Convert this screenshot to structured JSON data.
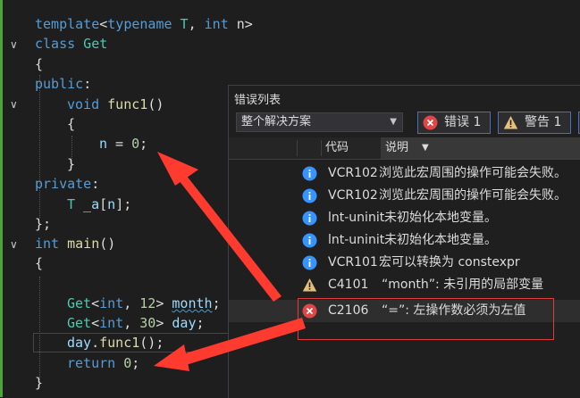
{
  "code": {
    "lines": [
      {
        "id": "l1",
        "tokens": [
          {
            "c": "kw",
            "t": "template"
          },
          {
            "c": "pl",
            "t": "<"
          },
          {
            "c": "kw",
            "t": "typename"
          },
          {
            "c": "ty",
            "t": " T"
          },
          {
            "c": "pl",
            "t": ", "
          },
          {
            "c": "kw",
            "t": "int"
          },
          {
            "c": "pl",
            "t": " n>"
          }
        ]
      },
      {
        "id": "l2",
        "tokens": [
          {
            "c": "kw",
            "t": "class"
          },
          {
            "c": "ty",
            "t": " Get"
          }
        ]
      },
      {
        "id": "l3",
        "tokens": [
          {
            "c": "pl",
            "t": "{"
          }
        ]
      },
      {
        "id": "l4",
        "tokens": [
          {
            "c": "kw",
            "t": "public"
          },
          {
            "c": "pl",
            "t": ":"
          }
        ]
      },
      {
        "id": "l5",
        "tokens": [
          {
            "c": "kw",
            "t": "void"
          },
          {
            "c": "fn",
            "t": " func1"
          },
          {
            "c": "pl",
            "t": "()"
          }
        ]
      },
      {
        "id": "l6",
        "tokens": [
          {
            "c": "pl",
            "t": "{"
          }
        ]
      },
      {
        "id": "l7",
        "tokens": [
          {
            "c": "vr",
            "t": "n"
          },
          {
            "c": "pl",
            "t": " = "
          },
          {
            "c": "nm",
            "t": "0"
          },
          {
            "c": "pl",
            "t": ";"
          }
        ]
      },
      {
        "id": "l8",
        "tokens": [
          {
            "c": "pl",
            "t": "}"
          }
        ]
      },
      {
        "id": "l9",
        "tokens": [
          {
            "c": "kw",
            "t": "private"
          },
          {
            "c": "pl",
            "t": ":"
          }
        ]
      },
      {
        "id": "l10",
        "tokens": [
          {
            "c": "ty",
            "t": "T"
          },
          {
            "c": "vr",
            "t": " _a"
          },
          {
            "c": "pl",
            "t": "["
          },
          {
            "c": "vr",
            "t": "n"
          },
          {
            "c": "pl",
            "t": "];"
          }
        ]
      },
      {
        "id": "l11",
        "tokens": [
          {
            "c": "pl",
            "t": "};"
          }
        ]
      },
      {
        "id": "l12",
        "tokens": [
          {
            "c": "kw",
            "t": "int"
          },
          {
            "c": "fn",
            "t": " main"
          },
          {
            "c": "pl",
            "t": "()"
          }
        ]
      },
      {
        "id": "l13",
        "tokens": [
          {
            "c": "pl",
            "t": "{"
          }
        ]
      },
      {
        "id": "l14",
        "tokens": []
      },
      {
        "id": "l15",
        "tokens": [
          {
            "c": "ty",
            "t": "Get"
          },
          {
            "c": "pl",
            "t": "<"
          },
          {
            "c": "kw",
            "t": "int"
          },
          {
            "c": "pl",
            "t": ", "
          },
          {
            "c": "nm",
            "t": "12"
          },
          {
            "c": "pl",
            "t": "> "
          },
          {
            "c": "vr squig",
            "t": "month"
          },
          {
            "c": "pl",
            "t": ";"
          }
        ]
      },
      {
        "id": "l16",
        "tokens": [
          {
            "c": "ty",
            "t": "Get"
          },
          {
            "c": "pl",
            "t": "<"
          },
          {
            "c": "kw",
            "t": "int"
          },
          {
            "c": "pl",
            "t": ", "
          },
          {
            "c": "nm",
            "t": "30"
          },
          {
            "c": "pl",
            "t": "> "
          },
          {
            "c": "vr",
            "t": "day"
          },
          {
            "c": "pl",
            "t": ";"
          }
        ]
      },
      {
        "id": "l17",
        "tokens": [
          {
            "c": "vr",
            "t": "day"
          },
          {
            "c": "pl",
            "t": "."
          },
          {
            "c": "fn",
            "t": "func1"
          },
          {
            "c": "pl",
            "t": "();"
          }
        ]
      },
      {
        "id": "l18",
        "tokens": [
          {
            "c": "kw",
            "t": "return"
          },
          {
            "c": "nm",
            "t": " 0"
          },
          {
            "c": "pl",
            "t": ";"
          }
        ]
      },
      {
        "id": "l19",
        "tokens": [
          {
            "c": "pl",
            "t": "}"
          }
        ]
      }
    ]
  },
  "error_list": {
    "title": "错误列表",
    "scope": {
      "selected": "整个解决方案"
    },
    "errors_filter": {
      "label": "错误 1"
    },
    "warnings_filter": {
      "label": "警告 1"
    },
    "columns": {
      "code": "代码",
      "description": "说明"
    },
    "rows": [
      {
        "severity": "info",
        "icon": "info-icon",
        "code": "VCR102",
        "description": "浏览此宏周围的操作可能会失败。"
      },
      {
        "severity": "info",
        "icon": "info-icon",
        "code": "VCR102",
        "description": "浏览此宏周围的操作可能会失败。"
      },
      {
        "severity": "info",
        "icon": "info-icon",
        "code": "lnt-uninit",
        "description": "未初始化本地变量。"
      },
      {
        "severity": "info",
        "icon": "info-icon",
        "code": "lnt-uninit",
        "description": "未初始化本地变量。"
      },
      {
        "severity": "info",
        "icon": "info-icon",
        "code": "VCR101",
        "description": "宏可以转换为 constexpr"
      },
      {
        "severity": "warning",
        "icon": "warning-icon",
        "code": "C4101",
        "description": "“month”: 未引用的局部变量"
      },
      {
        "severity": "error",
        "icon": "error-icon",
        "code": "C2106",
        "description": "“=”: 左操作数必须为左值"
      }
    ]
  },
  "colors": {
    "info": "#3794ff",
    "warning": "#e5c07b",
    "error": "#e04646",
    "annotation": "#ff3b30"
  }
}
